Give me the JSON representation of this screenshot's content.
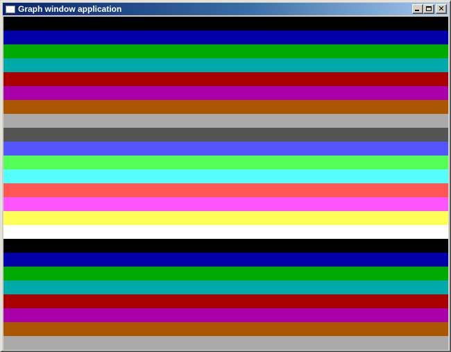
{
  "window": {
    "title": "Graph window application"
  },
  "title_buttons": {
    "minimize_icon": "minimize-icon",
    "maximize_icon": "maximize-icon",
    "close_icon": "close-icon",
    "close_glyph": "✕"
  },
  "stripes": [
    {
      "name": "black",
      "color": "#000000"
    },
    {
      "name": "blue",
      "color": "#0000aa"
    },
    {
      "name": "green",
      "color": "#00aa00"
    },
    {
      "name": "cyan",
      "color": "#00aaaa"
    },
    {
      "name": "red",
      "color": "#aa0000"
    },
    {
      "name": "magenta",
      "color": "#aa00aa"
    },
    {
      "name": "brown",
      "color": "#aa5500"
    },
    {
      "name": "light-gray",
      "color": "#aaaaaa"
    },
    {
      "name": "dark-gray",
      "color": "#555555"
    },
    {
      "name": "light-blue",
      "color": "#5555ff"
    },
    {
      "name": "light-green",
      "color": "#55ff55"
    },
    {
      "name": "light-cyan",
      "color": "#55ffff"
    },
    {
      "name": "light-red",
      "color": "#ff5555"
    },
    {
      "name": "light-magenta",
      "color": "#ff55ff"
    },
    {
      "name": "yellow",
      "color": "#ffff55"
    },
    {
      "name": "white",
      "color": "#ffffff"
    },
    {
      "name": "black",
      "color": "#000000"
    },
    {
      "name": "blue",
      "color": "#0000aa"
    },
    {
      "name": "green",
      "color": "#00aa00"
    },
    {
      "name": "cyan",
      "color": "#00aaaa"
    },
    {
      "name": "red",
      "color": "#aa0000"
    },
    {
      "name": "magenta",
      "color": "#aa00aa"
    },
    {
      "name": "brown",
      "color": "#aa5500"
    },
    {
      "name": "light-gray",
      "color": "#aaaaaa"
    }
  ]
}
